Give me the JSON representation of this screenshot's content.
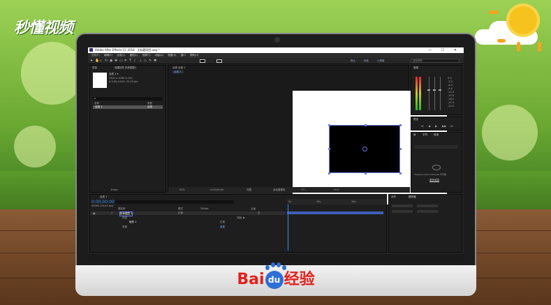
{
  "watermark_left": "秒懂视频",
  "baidu": {
    "bai": "Bai",
    "du": "du",
    "jingyan": "经验"
  },
  "app": {
    "title": "Adobe After Effects CC 2018 - 无标题项目.aep *",
    "menu": [
      "文件(F)",
      "编辑(E)",
      "合成(C)",
      "图层(L)",
      "效果(T)",
      "动画(A)",
      "视图(V)",
      "窗口",
      "帮助(H)"
    ],
    "toolbar_right": [
      "默认",
      "标准",
      "小屏幕"
    ],
    "search_help": "搜索帮助"
  },
  "project_panel": {
    "tab": "项目",
    "effect_tab": "效果控件 形状图层1",
    "comp_name": "合成 1 ▾",
    "comp_info_1": "1920 x 1080 (1.00)",
    "comp_info_2": "Δ 0;00;10;00, 25.00 fps",
    "search_placeholder": "ρ",
    "col_name": "名称",
    "col_type": "类型",
    "item_name": "合成 1",
    "item_type": "合成",
    "bpc": "8 bpc"
  },
  "comp_panel": {
    "tab": "合成 合成 1",
    "sub_tab": "合成 1",
    "zoom": "50%",
    "time": "0;00;00;00",
    "quality": "完整",
    "camera": "活动摄像机",
    "views": "1个...",
    "offset": "+0.0"
  },
  "info_panel": {
    "tab": "音频",
    "levels": [
      "0.0",
      "-3.0",
      "-6.0",
      "-9.0",
      "-12.0",
      "-15.0",
      "-18.0",
      "-21.0",
      "-24.0"
    ]
  },
  "preview_panel": {
    "tab": "预览",
    "controls": [
      "⏮",
      "◀",
      "▶",
      "▶▶",
      "⏭"
    ]
  },
  "library_panel": {
    "tab": "库",
    "tabs2": [
      "字符",
      "段落"
    ],
    "message": "Creative Cloud Libraries 不可用",
    "link": "更多信息"
  },
  "timeline": {
    "tab": "合成 1",
    "time": "0:00:00:00",
    "fps_info": "00000 (25.00 fps)",
    "col_source": "源名称",
    "col_mode": "模式",
    "col_trkmat": "TrkMat",
    "col_parent": "父级",
    "layer_num": "1",
    "layer_name": "形状图层 1",
    "layer_mode": "正常",
    "layer_parent": "无",
    "contents": "内容",
    "add": "添加: ▶",
    "rect_group": "矩形 1",
    "rect_mode": "正常",
    "transform": "变换",
    "reset": "重置",
    "ruler": [
      "0s",
      "05s",
      "10s"
    ]
  },
  "align_panel": {
    "tab1": "对齐",
    "tab2": "跟踪器"
  }
}
